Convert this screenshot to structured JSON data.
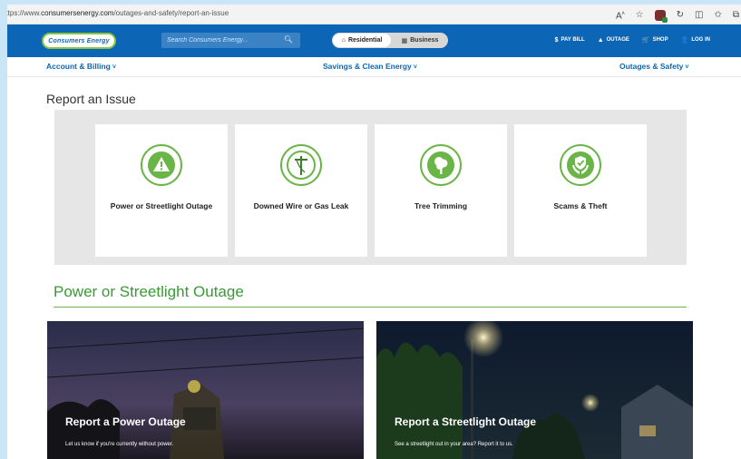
{
  "browser": {
    "url_prefix": "https://www.",
    "url_host": "consumersenergy.com",
    "url_path": "/outages-and-safety/report-an-issue",
    "icons": [
      "read-aloud-icon",
      "favorite-icon",
      "extension-icon",
      "refresh-icon",
      "split-screen-icon",
      "favorites-icon",
      "collections-icon"
    ]
  },
  "header": {
    "logo_text": "Consumers Energy",
    "search_placeholder": "Search Consumers Energy...",
    "toggle": {
      "residential": "Residential",
      "business": "Business"
    },
    "utility": [
      {
        "glyph": "$",
        "label": "PAY BILL"
      },
      {
        "glyph": "▲",
        "label": "OUTAGE"
      },
      {
        "glyph": "🛒",
        "label": "SHOP"
      },
      {
        "glyph": "👤",
        "label": "LOG IN"
      }
    ]
  },
  "nav": {
    "account": "Account & Billing",
    "savings": "Savings & Clean Energy",
    "outages": "Outages & Safety"
  },
  "page": {
    "title": "Report an Issue",
    "cards": [
      {
        "label": "Power or Streetlight Outage",
        "icon": "warning-icon"
      },
      {
        "label": "Downed Wire or Gas Leak",
        "icon": "utility-pole-icon"
      },
      {
        "label": "Tree Trimming",
        "icon": "tree-icon"
      },
      {
        "label": "Scams & Theft",
        "icon": "shield-hands-icon"
      }
    ],
    "section_title": "Power or Streetlight Outage",
    "tiles": [
      {
        "heading": "Report a Power Outage",
        "sub": "Let us know if you're currently without power."
      },
      {
        "heading": "Report a Streetlight Outage",
        "sub": "See a streetlight out in your area? Report it to us."
      }
    ]
  },
  "colors": {
    "brand_blue": "#0d66b5",
    "brand_green": "#6ab547"
  }
}
